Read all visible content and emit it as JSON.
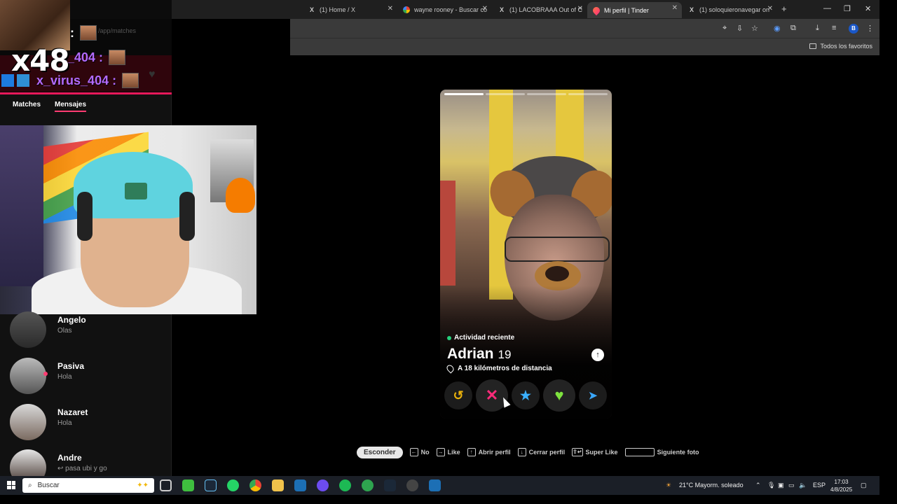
{
  "browser": {
    "tabs": [
      {
        "title": "(1) Home / X",
        "icon": "x-logo-icon",
        "active": false
      },
      {
        "title": "wayne rooney - Buscar co",
        "icon": "google-icon",
        "active": false
      },
      {
        "title": "(1) LACOBRAAA Out of C",
        "icon": "x-logo-icon",
        "active": false
      },
      {
        "title": "Mi perfil | Tinder",
        "icon": "tinder-flame-icon",
        "active": true
      },
      {
        "title": "(1) soloquieronavegar on",
        "icon": "x-logo-icon",
        "active": false
      }
    ],
    "new_tab": "+",
    "profile_initial": "B",
    "bookmarks_all": "Todos los favoritos",
    "obscured_url": "/app/matches"
  },
  "overlay": {
    "multiplier": "x48",
    "gifts": [
      {
        "user": "s_404 :"
      },
      {
        "user": "x_virus_404 :"
      }
    ],
    "colon_label": ":"
  },
  "sidebar": {
    "tabs": [
      {
        "label": "Matches",
        "active": false
      },
      {
        "label": "Mensajes",
        "active": true
      }
    ],
    "conversations": [
      {
        "name": "Angelo",
        "message": "Olas",
        "unread": false
      },
      {
        "name": "Pasiva",
        "message": "Hola",
        "unread": true
      },
      {
        "name": "Nazaret",
        "message": "Hola",
        "unread": false
      },
      {
        "name": "Andre",
        "message": "↩ pasa ubi y go",
        "unread": false
      }
    ]
  },
  "profile": {
    "activity": "Actividad reciente",
    "name": "Adrian",
    "age": "19",
    "distance": "A 18 kilómetros de distancia",
    "photo_count": 4,
    "current_photo": 1
  },
  "actions": [
    {
      "name": "rewind-button",
      "icon": "rewind-icon",
      "glyph": "↺",
      "color": "#e8b10c"
    },
    {
      "name": "nope-button",
      "icon": "close-icon",
      "glyph": "✕",
      "color": "#fe2b7a"
    },
    {
      "name": "super-like-button",
      "icon": "star-icon",
      "glyph": "★",
      "color": "#3ab0ff"
    },
    {
      "name": "like-button",
      "icon": "heart-icon",
      "glyph": "♥",
      "color": "#7ee33e"
    },
    {
      "name": "boost-button",
      "icon": "send-icon",
      "glyph": "➤",
      "color": "#3aa8ff"
    }
  ],
  "hints": {
    "hide": "Esconder",
    "items": [
      {
        "key": "←",
        "label": "No"
      },
      {
        "key": "→",
        "label": "Like"
      },
      {
        "key": "↑",
        "label": "Abrir perfil"
      },
      {
        "key": "↓",
        "label": "Cerrar perfil"
      },
      {
        "key": "⇧↵",
        "label": "Super Like"
      },
      {
        "key": "",
        "label": "Siguiente foto"
      }
    ]
  },
  "taskbar": {
    "search_placeholder": "Buscar",
    "weather": "21°C  Mayorm. soleado",
    "language": "ESP",
    "time": "17:03",
    "date": "4/8/2025"
  }
}
